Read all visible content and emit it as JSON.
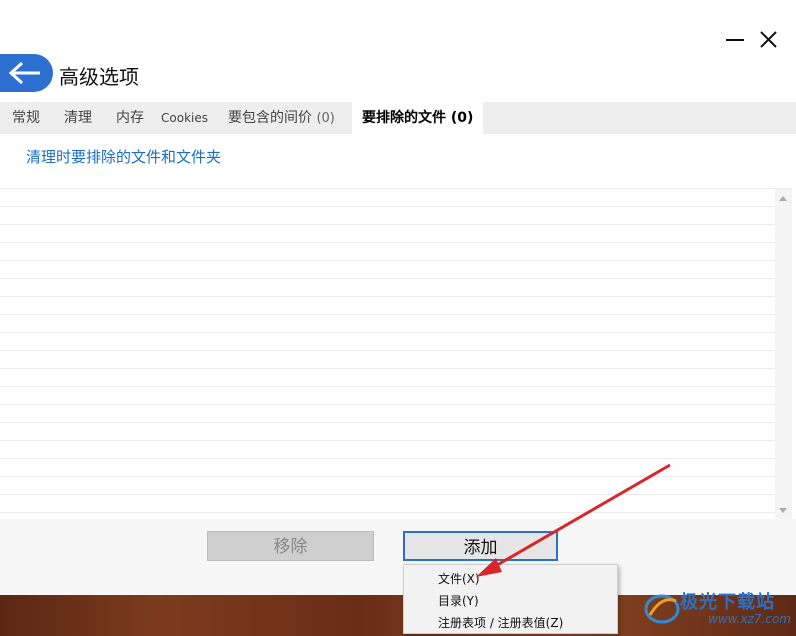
{
  "window": {
    "minimize_icon": "minimize-icon",
    "close_icon": "close-icon"
  },
  "header": {
    "back_icon": "arrow-left-icon",
    "title": "高级选项"
  },
  "tabs": [
    {
      "label": "常规"
    },
    {
      "label": "清理"
    },
    {
      "label": "内存"
    },
    {
      "label": "Cookies"
    },
    {
      "label": "要包含的间价",
      "count": "(0)"
    },
    {
      "label": "要排除的文件",
      "count": "(0)",
      "active": true
    }
  ],
  "section": {
    "subtitle": "清理时要排除的文件和文件夹"
  },
  "list": {
    "items": []
  },
  "buttons": {
    "remove": "移除",
    "add": "添加"
  },
  "context_menu": {
    "items": [
      "文件(X)",
      "目录(Y)",
      "注册表项 / 注册表值(Z)"
    ]
  },
  "watermark": {
    "text": "极光下载站",
    "url": "www.xz7.com"
  },
  "colors": {
    "accent": "#2c6fd1",
    "link": "#1a6fc4",
    "arrow": "#d9262c"
  }
}
